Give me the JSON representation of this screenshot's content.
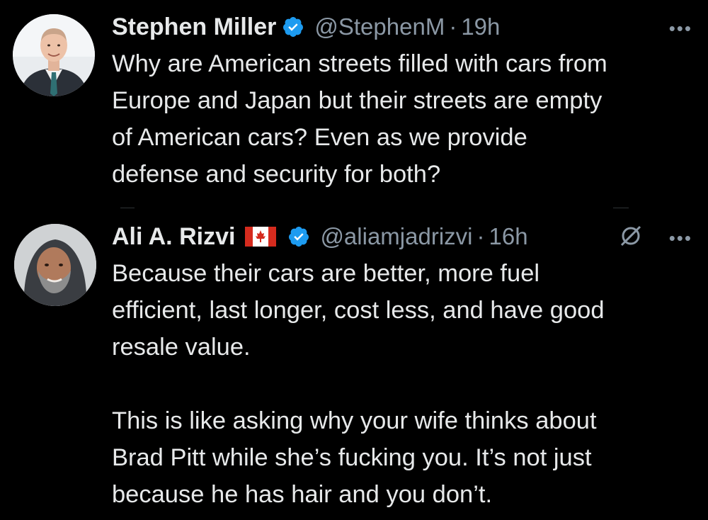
{
  "tweets": [
    {
      "author_name": "Stephen Miller",
      "handle": "@StephenM",
      "separator": "·",
      "time": "19h",
      "more": "•••",
      "body_lines": [
        "Why are American streets filled with cars from",
        "Europe and Japan but their streets are empty",
        "of American cars? Even as we provide",
        "defense and security for both?"
      ]
    },
    {
      "author_name": "Ali A. Rizvi",
      "handle": "@aliamjadrizvi",
      "separator": "·",
      "time": "16h",
      "more": "•••",
      "body_lines": [
        "Because their cars are better, more fuel",
        "efficient, last longer, cost less, and have good",
        "resale value."
      ],
      "body_lines_2": [
        "This is like asking why your wife thinks about",
        "Brad Pitt while she’s fucking you. It’s not just",
        "because he has hair and you don’t."
      ]
    }
  ],
  "colors": {
    "background": "#000000",
    "text": "#e7e9ea",
    "muted": "#8b98a5",
    "verified_blue": "#1d9bf0",
    "flag_red": "#d52b1e"
  },
  "icons": [
    "verified-badge-icon",
    "canada-flag-icon",
    "more-options-icon",
    "muted-conversation-icon"
  ]
}
